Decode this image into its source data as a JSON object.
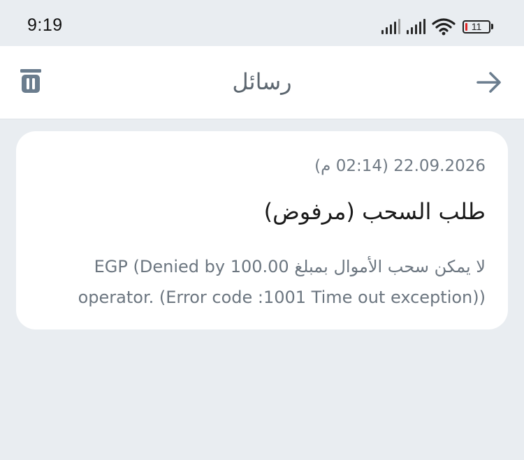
{
  "status_bar": {
    "time": "9:19",
    "battery_level": "11",
    "battery_color": "#e02424"
  },
  "header": {
    "title": "رسائل",
    "delete_icon": "trash-icon",
    "back_icon": "arrow-right-icon",
    "icon_color": "#6b7d8e"
  },
  "message": {
    "date": "22.09.2026 (02:14 م)",
    "title": "طلب السحب (مرفوض)",
    "body_line1": "لا يمكن سحب الأموال بمبلغ 100.00 EGP (Denied by",
    "body_line2": "operator. (Error code :1001 Time out exception))"
  }
}
